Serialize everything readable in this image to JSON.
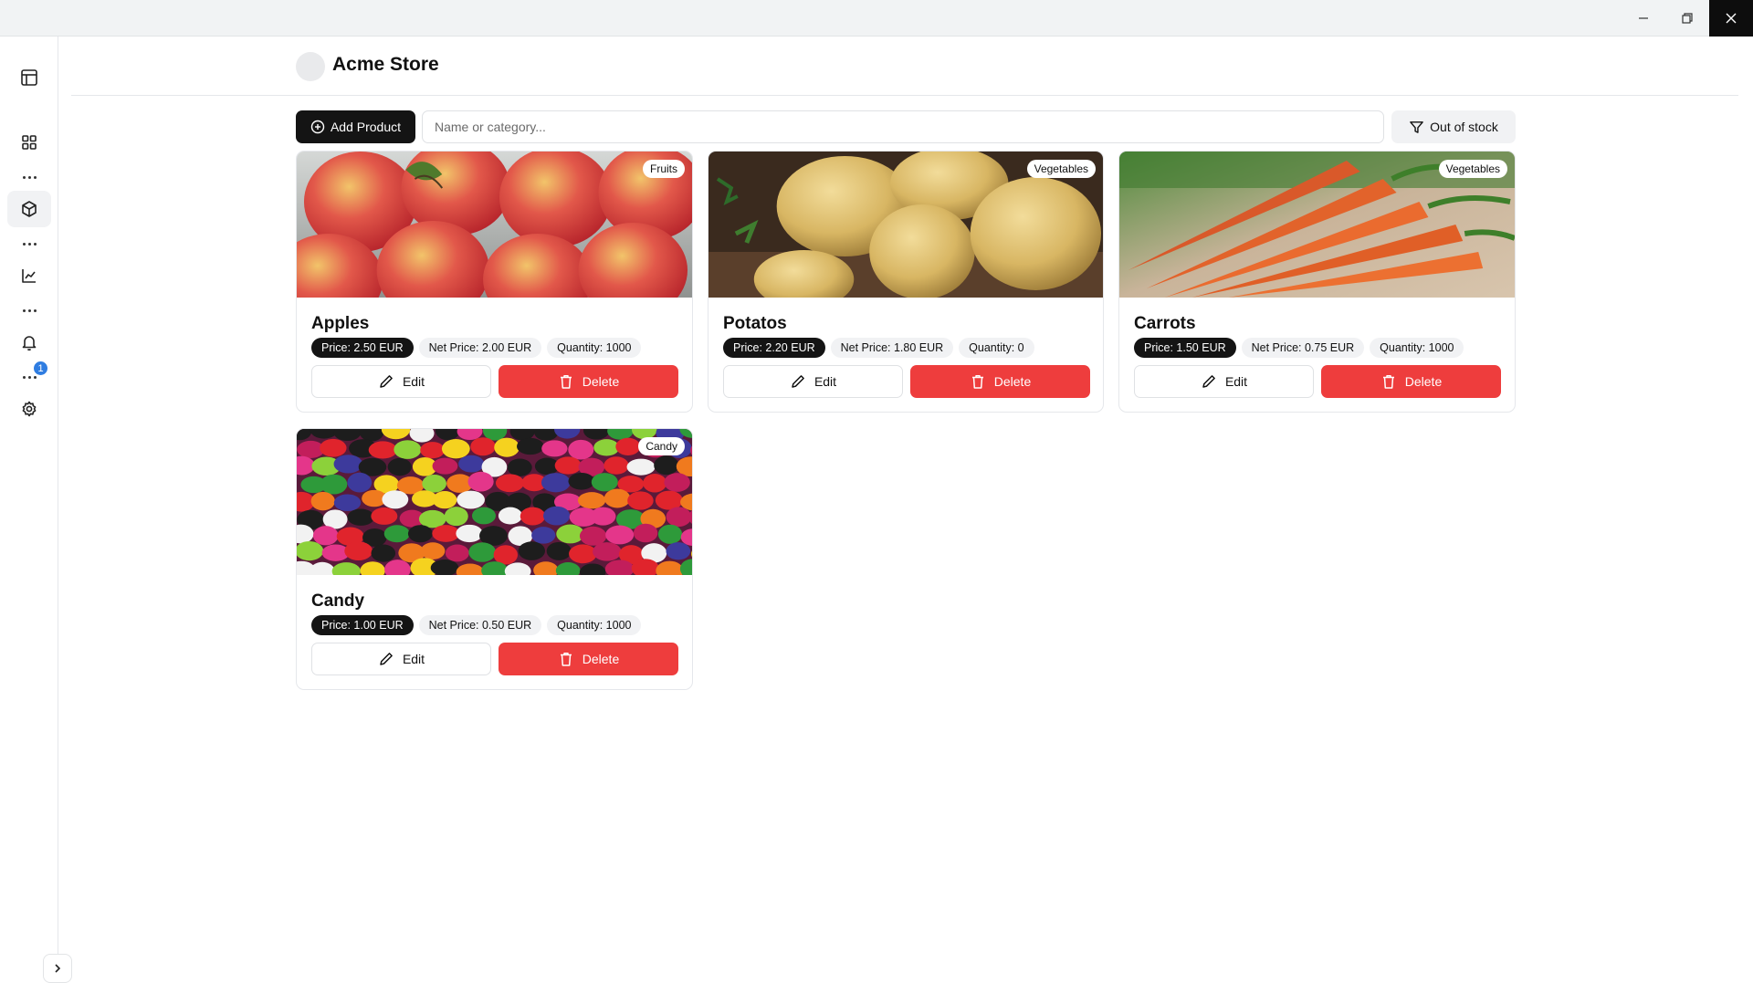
{
  "window": {
    "minimize_icon": "minimize-icon",
    "maximize_icon": "restore-icon",
    "close_icon": "close-icon"
  },
  "sidebar": {
    "icons": [
      "layout-icon",
      "grid-icon",
      "package-icon",
      "chart-icon",
      "bell-icon",
      "gear-icon"
    ],
    "notification_count": "1",
    "toggle_icon": "chevron-right-icon"
  },
  "header": {
    "store_name": "Acme Store"
  },
  "toolbar": {
    "add_label": "Add Product",
    "search_placeholder": "Name or category...",
    "filter_label": "Out of stock"
  },
  "colors": {
    "primary": "#141414",
    "danger": "#ee3d3d",
    "badge": "#2f7de1"
  },
  "products": [
    {
      "name": "Apples",
      "category": "Fruits",
      "price": "Price: 2.50 EUR",
      "net_price": "Net Price: 2.00 EUR",
      "quantity": "Quantity: 1000",
      "edit": "Edit",
      "delete": "Delete"
    },
    {
      "name": "Potatos",
      "category": "Vegetables",
      "price": "Price: 2.20 EUR",
      "net_price": "Net Price: 1.80 EUR",
      "quantity": "Quantity: 0",
      "edit": "Edit",
      "delete": "Delete"
    },
    {
      "name": "Carrots",
      "category": "Vegetables",
      "price": "Price: 1.50 EUR",
      "net_price": "Net Price: 0.75 EUR",
      "quantity": "Quantity: 1000",
      "edit": "Edit",
      "delete": "Delete"
    },
    {
      "name": "Candy",
      "category": "Candy",
      "price": "Price: 1.00 EUR",
      "net_price": "Net Price: 0.50 EUR",
      "quantity": "Quantity: 1000",
      "edit": "Edit",
      "delete": "Delete"
    }
  ]
}
